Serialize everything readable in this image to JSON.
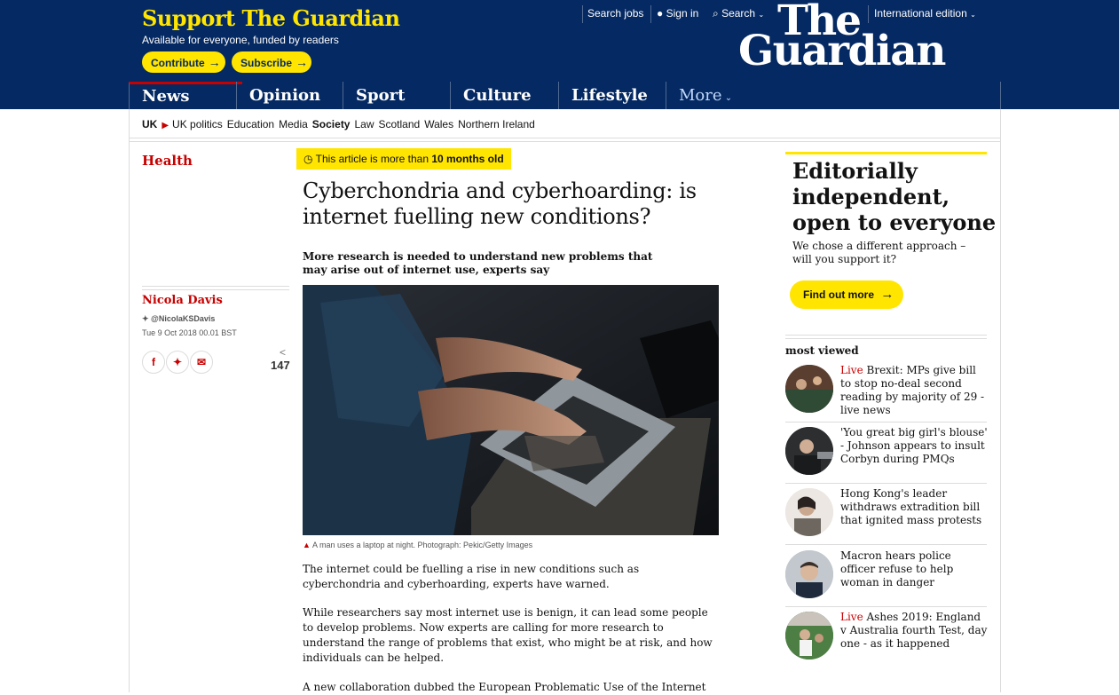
{
  "support": {
    "title": "Support The Guardian",
    "subtitle": "Available for everyone, funded by readers",
    "contribute_label": "Contribute",
    "subscribe_label": "Subscribe"
  },
  "toplinks": {
    "search_jobs": "Search jobs",
    "sign_in": "Sign in",
    "search": "Search",
    "edition": "International edition"
  },
  "logo": {
    "line1": "The",
    "line2": "Guardian"
  },
  "nav": {
    "items": [
      "News",
      "Opinion",
      "Sport",
      "Culture",
      "Lifestyle"
    ],
    "more": "More"
  },
  "subnav": {
    "uk": "UK",
    "items": [
      "UK politics",
      "Education",
      "Media",
      "Society",
      "Law",
      "Scotland",
      "Wales",
      "Northern Ireland"
    ]
  },
  "article": {
    "section": "Health",
    "age_prefix": "This article is more than ",
    "age_bold": "10 months old",
    "headline": "Cyberchondria and cyberhoarding: is internet fuelling new conditions?",
    "standfirst": "More research is needed to understand new problems that may arise out of internet use, experts say",
    "author": "Nicola Davis",
    "twitter": "@NicolaKSDavis",
    "date": "Tue 9 Oct 2018 00.01 BST",
    "share_count": "147",
    "caption": "A man uses a laptop at night. Photograph: Pekic/Getty Images",
    "paragraphs": [
      "The internet could be fuelling a rise in new conditions such as cyberchondria and cyberhoarding, experts have warned.",
      "While researchers say most internet use is benign, it can lead some people to develop problems. Now experts are calling for more research to understand the range of problems that exist, who might be at risk, and how individuals can be helped.",
      "A new collaboration dubbed the European Problematic Use of the Internet"
    ]
  },
  "promo": {
    "title": "Editorially independent, open to everyone",
    "text": "We chose a different approach – will you support it?",
    "button": "Find out more"
  },
  "most_viewed": {
    "heading": "most viewed",
    "items": [
      {
        "live": "Live",
        "text": "Brexit: MPs give bill to stop no-deal second reading by majority of 29 - live news"
      },
      {
        "live": "",
        "text": "'You great big girl's blouse' - Johnson appears to insult Corbyn during PMQs"
      },
      {
        "live": "",
        "text": "Hong Kong's leader withdraws extradition bill that ignited mass protests"
      },
      {
        "live": "",
        "text": "Macron hears police officer refuse to help woman in danger"
      },
      {
        "live": "Live",
        "text": "Ashes 2019: England v Australia fourth Test, day one - as it happened"
      }
    ]
  },
  "colors": {
    "brand_blue": "#052962",
    "yellow": "#ffe500",
    "news_red": "#c70000"
  }
}
